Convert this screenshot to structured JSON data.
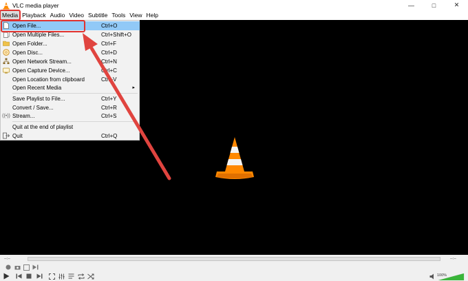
{
  "window": {
    "title": "VLC media player"
  },
  "menubar": [
    "Media",
    "Playback",
    "Audio",
    "Video",
    "Subtitle",
    "Tools",
    "View",
    "Help"
  ],
  "menu": {
    "items": [
      {
        "label": "Open File...",
        "shortcut": "Ctrl+O",
        "icon": "file-icon"
      },
      {
        "label": "Open Multiple Files...",
        "shortcut": "Ctrl+Shift+O",
        "icon": "files-icon"
      },
      {
        "label": "Open Folder...",
        "shortcut": "Ctrl+F",
        "icon": "folder-icon"
      },
      {
        "label": "Open Disc...",
        "shortcut": "Ctrl+D",
        "icon": "disc-icon"
      },
      {
        "label": "Open Network Stream...",
        "shortcut": "Ctrl+N",
        "icon": "network-icon"
      },
      {
        "label": "Open Capture Device...",
        "shortcut": "Ctrl+C",
        "icon": "capture-icon"
      },
      {
        "label": "Open Location from clipboard",
        "shortcut": "Ctrl+V",
        "icon": ""
      },
      {
        "label": "Open Recent Media",
        "shortcut": "",
        "icon": ""
      },
      {
        "label": "Save Playlist to File...",
        "shortcut": "Ctrl+Y",
        "icon": ""
      },
      {
        "label": "Convert / Save...",
        "shortcut": "Ctrl+R",
        "icon": ""
      },
      {
        "label": "Stream...",
        "shortcut": "Ctrl+S",
        "icon": "stream-icon"
      },
      {
        "label": "Quit at the end of playlist",
        "shortcut": "",
        "icon": ""
      },
      {
        "label": "Quit",
        "shortcut": "Ctrl+Q",
        "icon": "quit-icon"
      }
    ]
  },
  "controls": {
    "time_elapsed": "--:--",
    "time_total": "--:--",
    "volume": "100%"
  },
  "colors": {
    "highlight": "#91c9f7",
    "annotation": "#e0322f",
    "cone": "#ff8800"
  }
}
